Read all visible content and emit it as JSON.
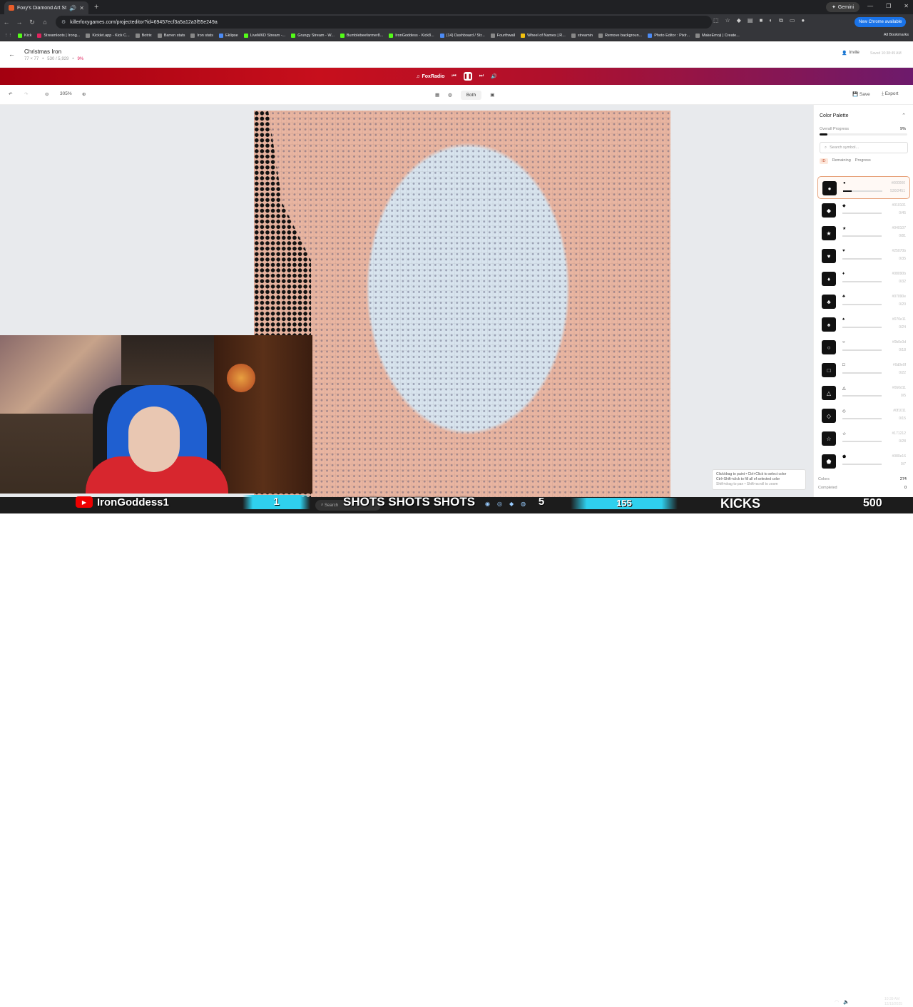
{
  "browser": {
    "tab_title": "Foxy's Diamond Art Studio",
    "url": "killerfoxygames.com/projecteditor?id=69457ecf3a5a12a3f55e249a",
    "gemini_label": "Gemini",
    "update_label": "New Chrome available",
    "bookmarks": [
      "Kick",
      "Streamloots | Irong...",
      "Kicklet.app - Kick C...",
      "Botrix",
      "Barren stats",
      "Iron stats",
      "Eklipse",
      "LiveMKD Stream -...",
      "Grungy Stream - W...",
      "Bumblebeefarmer8...",
      "IronGoddess - Kick8...",
      "(14) Dashboard / Str...",
      "Fourthwall",
      "Wheel of Names | R...",
      "streamin",
      "Remove backgroun...",
      "Photo Editor : Pixlr...",
      "MakeEmoji | Create..."
    ],
    "all_bookmarks": "All Bookmarks"
  },
  "header": {
    "title": "Christmas Iron",
    "dims": "77 × 77",
    "count": "530 / 5,929",
    "percent": "9%",
    "invite": "Invite",
    "saved": "Saved 10:38:49 AM"
  },
  "radio": {
    "label": "FoxRadio"
  },
  "toolbar": {
    "zoom": "305%",
    "view_mode": "Both",
    "save": "Save",
    "export": "Export"
  },
  "palette": {
    "title": "Color Palette",
    "overall_label": "Overall Progress",
    "overall_value": "9%",
    "overall_fraction": 0.09,
    "search_placeholder": "Search symbol...",
    "sort_tabs": [
      "ID",
      "Remaining",
      "Progress"
    ],
    "colors": [
      {
        "symbol": "●",
        "hex": "#000000",
        "count": "530/2451",
        "fraction": 0.216
      },
      {
        "symbol": "◆",
        "hex": "#010101",
        "count": "0/45",
        "fraction": 0
      },
      {
        "symbol": "★",
        "hex": "#040107",
        "count": "0/81",
        "fraction": 0
      },
      {
        "symbol": "♥",
        "hex": "#25070b",
        "count": "0/35",
        "fraction": 0
      },
      {
        "symbol": "♦",
        "hex": "#08090b",
        "count": "0/32",
        "fraction": 0
      },
      {
        "symbol": "♣",
        "hex": "#07090e",
        "count": "0/20",
        "fraction": 0
      },
      {
        "symbol": "♠",
        "hex": "#070e11",
        "count": "0/24",
        "fraction": 0
      },
      {
        "symbol": "○",
        "hex": "#0b0c0d",
        "count": "0/18",
        "fraction": 0
      },
      {
        "symbol": "□",
        "hex": "#0d0e0f",
        "count": "0/22",
        "fraction": 0
      },
      {
        "symbol": "△",
        "hex": "#0b0d11",
        "count": "0/5",
        "fraction": 0
      },
      {
        "symbol": "◇",
        "hex": "#0f1011",
        "count": "0/15",
        "fraction": 0
      },
      {
        "symbol": "☆",
        "hex": "#171212",
        "count": "0/28",
        "fraction": 0
      },
      {
        "symbol": "⬟",
        "hex": "#080e16",
        "count": "0/7",
        "fraction": 0
      }
    ],
    "colors_label": "Colors",
    "colors_value": "274",
    "completed_label": "Completed",
    "completed_value": "0"
  },
  "hint": {
    "line1": "Click/drag to paint • Ctrl+Click to select color",
    "line2": "Ctrl+Shift+click to fill all of selected color",
    "line3": "Shift+drag to pan • Shift+scroll to zoom"
  },
  "stream": {
    "name": "IronGoddess1",
    "counter1": "1",
    "shots": "SHOTS SHOTS SHOTS",
    "counter2": "5",
    "counter3": "155",
    "kicks": "KICKS",
    "counter4": "500",
    "search": "Search",
    "clock_time": "10:39 AM",
    "clock_date": "12/19/2025"
  }
}
